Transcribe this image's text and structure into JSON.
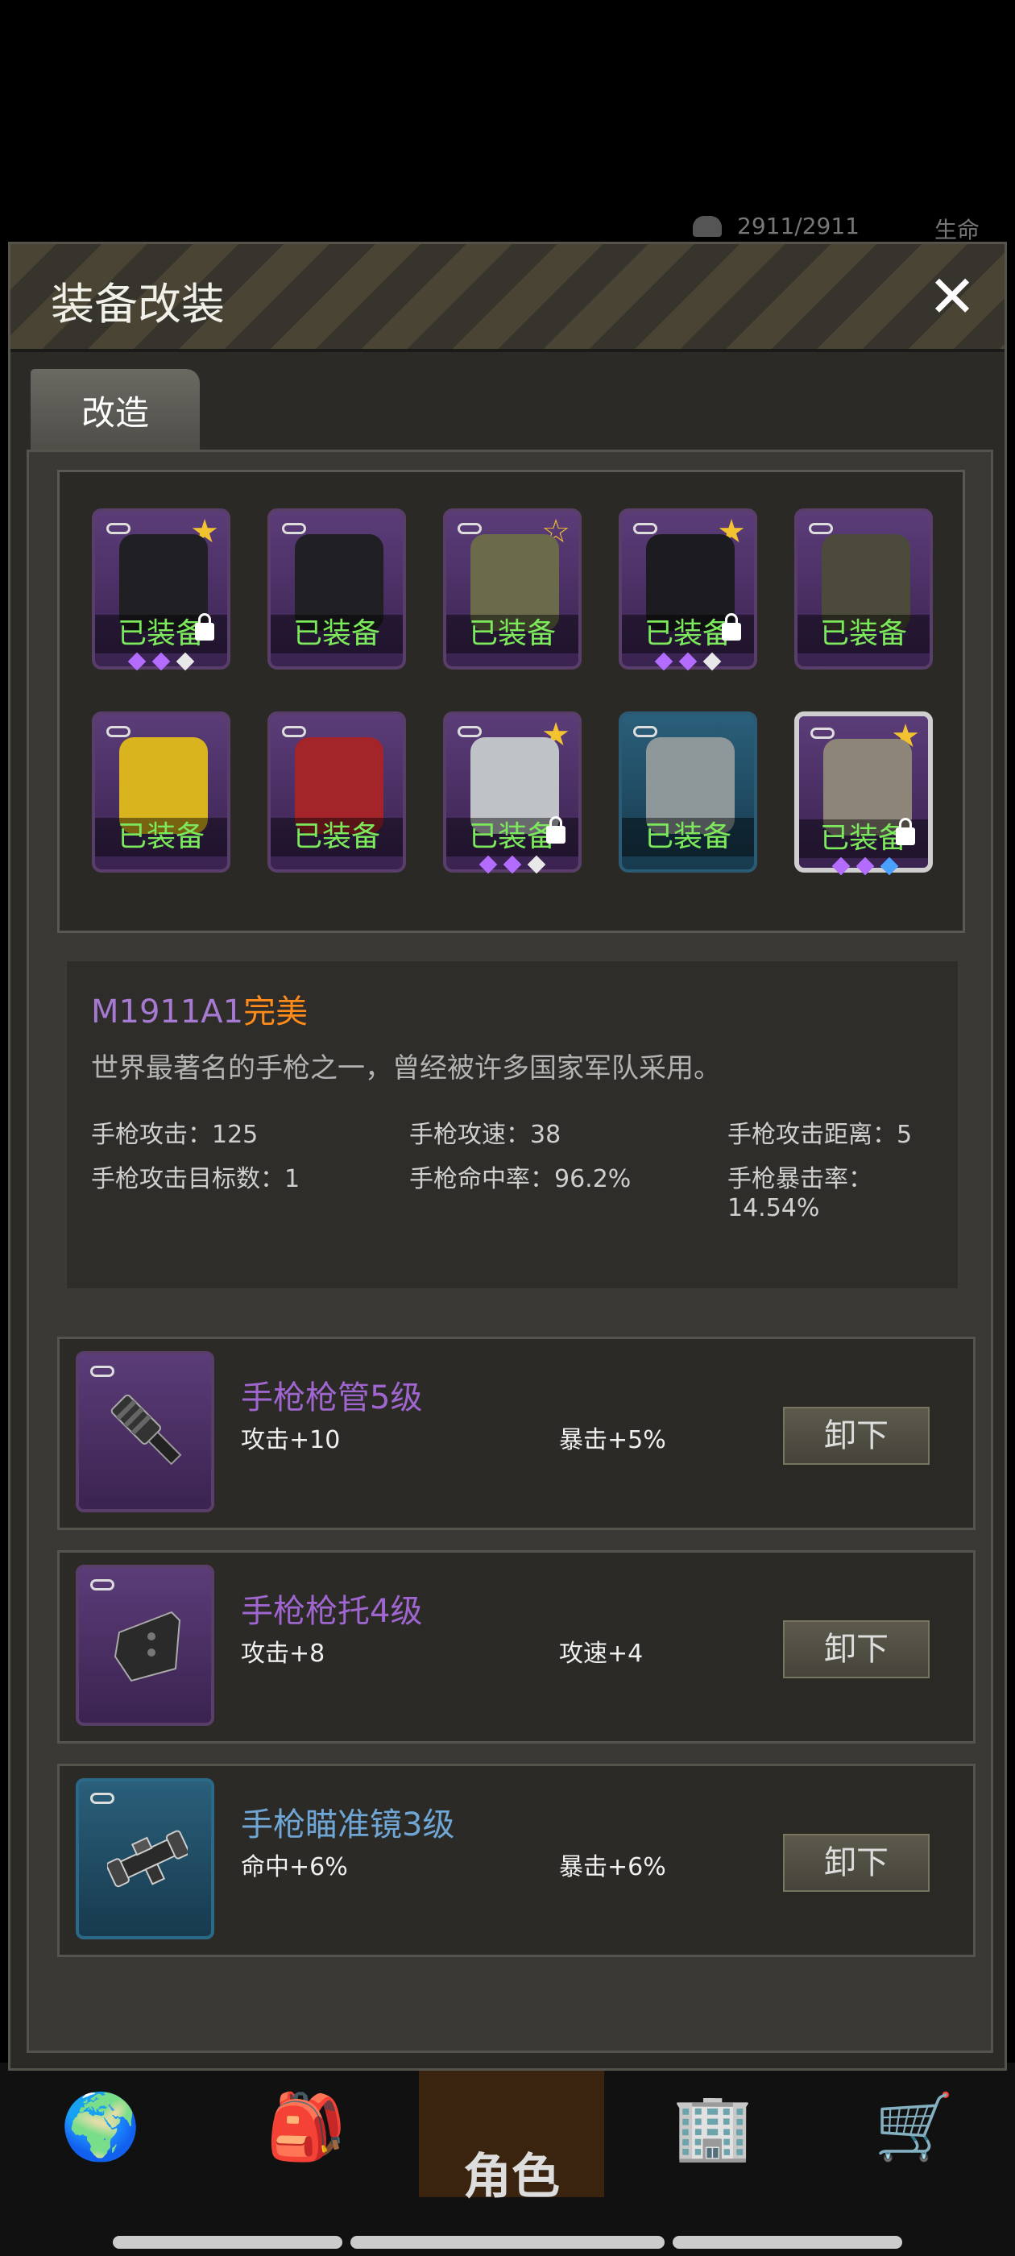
{
  "background": {
    "hud_hp": "2911/2911",
    "hud_life_label": "生命",
    "nav": {
      "active_label": "角色"
    }
  },
  "modal": {
    "title": "装备改装",
    "close_label": "✕",
    "tab_label": "改造"
  },
  "equipment": {
    "equipped_label": "已装备",
    "slots": [
      {
        "name": "pants-dark",
        "star": "filled",
        "locked": true,
        "gems": [
          "#b46cff",
          "#b46cff",
          "#e8e8e8"
        ],
        "frame": "purple"
      },
      {
        "name": "pants-dark-2",
        "star": "none",
        "locked": false,
        "gems": [],
        "frame": "purple"
      },
      {
        "name": "pants-camo",
        "star": "outline",
        "locked": false,
        "gems": [],
        "frame": "purple"
      },
      {
        "name": "jacket-dark",
        "star": "filled",
        "locked": true,
        "gems": [
          "#b46cff",
          "#b46cff",
          "#e8e8e8"
        ],
        "frame": "purple"
      },
      {
        "name": "parka",
        "star": "none",
        "locked": false,
        "gems": [],
        "frame": "purple"
      },
      {
        "name": "raincoat-yellow",
        "star": "none",
        "locked": false,
        "gems": [],
        "frame": "purple"
      },
      {
        "name": "football-helmet",
        "star": "none",
        "locked": false,
        "gems": [],
        "frame": "purple"
      },
      {
        "name": "police-helmet",
        "star": "filled",
        "locked": true,
        "gems": [
          "#b46cff",
          "#b46cff",
          "#e8e8e8"
        ],
        "frame": "purple"
      },
      {
        "name": "visor-helmet",
        "star": "none",
        "locked": false,
        "gems": [],
        "frame": "blue"
      },
      {
        "name": "pistol",
        "star": "filled",
        "locked": true,
        "gems": [
          "#b46cff",
          "#b46cff",
          "#4aa0ff"
        ],
        "frame": "purple",
        "selected": true
      }
    ]
  },
  "item": {
    "name": "M1911A1",
    "quality": "完美",
    "description": "世界最著名的手枪之一，曾经被许多国家军队采用。",
    "stats": [
      "手枪攻击：125",
      "手枪攻速：38",
      "手枪攻击距离：5",
      "手枪攻击目标数：1",
      "手枪命中率：96.2%",
      "手枪暴击率：14.54%"
    ]
  },
  "mods": [
    {
      "name": "手枪枪管5级",
      "stat1": "攻击+10",
      "stat2": "暴击+5%",
      "button": "卸下",
      "rarity": "purple"
    },
    {
      "name": "手枪枪托4级",
      "stat1": "攻击+8",
      "stat2": "攻速+4",
      "button": "卸下",
      "rarity": "purple"
    },
    {
      "name": "手枪瞄准镜3级",
      "stat1": "命中+6%",
      "stat2": "暴击+6%",
      "button": "卸下",
      "rarity": "blue"
    }
  ]
}
